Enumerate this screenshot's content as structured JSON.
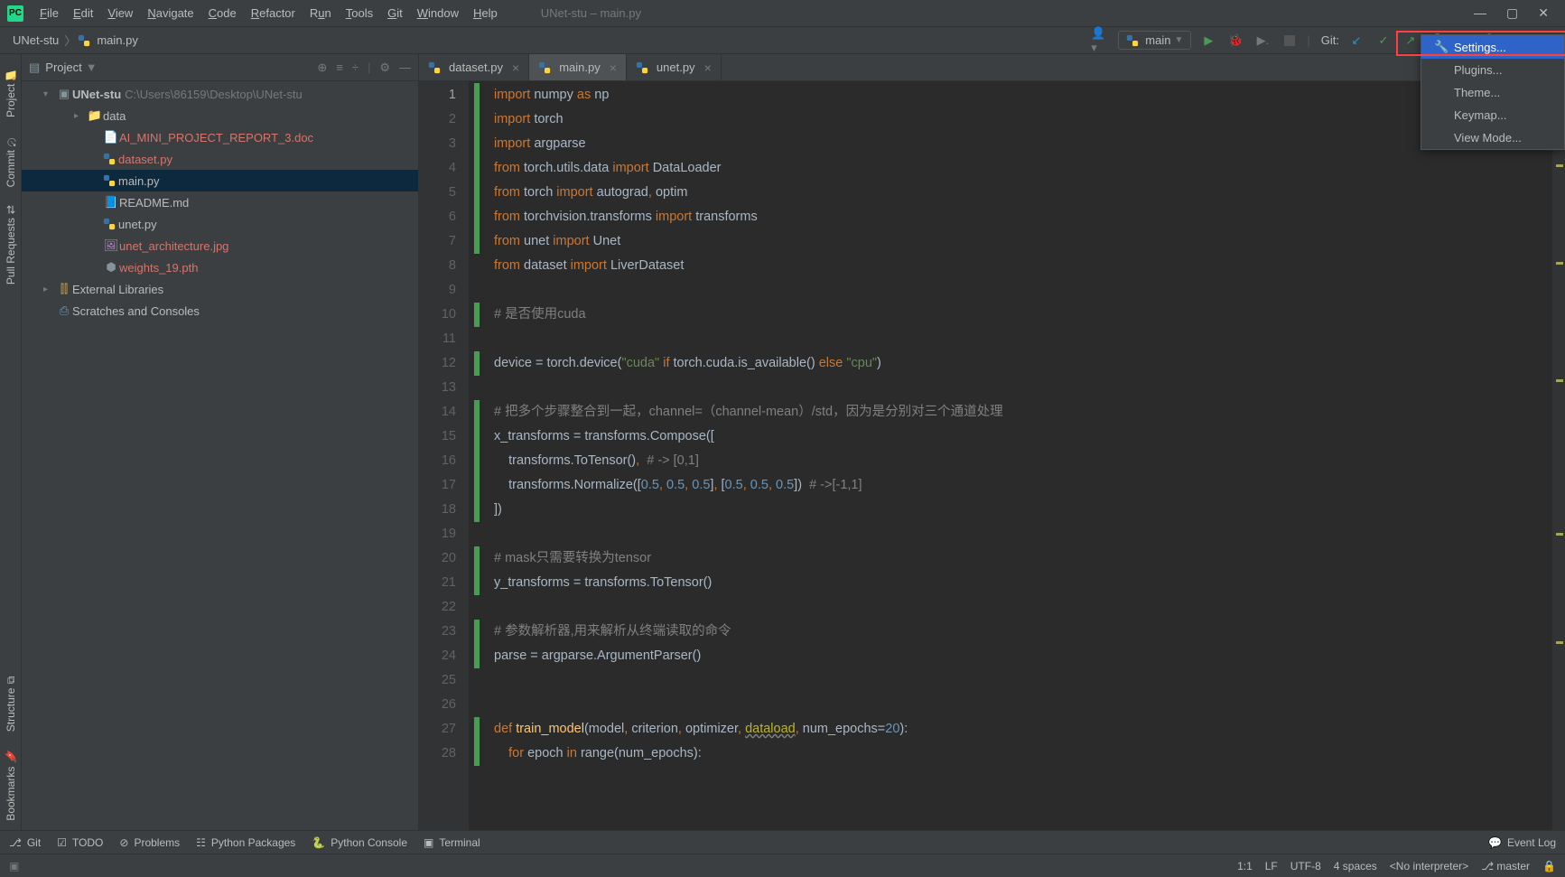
{
  "window": {
    "title": "UNet-stu – main.py"
  },
  "menu": [
    "File",
    "Edit",
    "View",
    "Navigate",
    "Code",
    "Refactor",
    "Run",
    "Tools",
    "Git",
    "Window",
    "Help"
  ],
  "breadcrumb": {
    "project": "UNet-stu",
    "file": "main.py"
  },
  "run_config": {
    "name": "main"
  },
  "git_label": "Git:",
  "project_panel": {
    "title": "Project",
    "root": {
      "name": "UNet-stu",
      "path": "C:\\Users\\86159\\Desktop\\UNet-stu"
    },
    "items": [
      {
        "name": "data",
        "type": "folder"
      },
      {
        "name": "AI_MINI_PROJECT_REPORT_3.doc",
        "type": "doc",
        "vcs": true
      },
      {
        "name": "dataset.py",
        "type": "py",
        "vcs": true
      },
      {
        "name": "main.py",
        "type": "py",
        "vcs": false,
        "selected": true
      },
      {
        "name": "README.md",
        "type": "md",
        "vcs": false
      },
      {
        "name": "unet.py",
        "type": "py",
        "vcs": false
      },
      {
        "name": "unet_architecture.jpg",
        "type": "img",
        "vcs": true
      },
      {
        "name": "weights_19.pth",
        "type": "bin",
        "vcs": true
      }
    ],
    "external": "External Libraries",
    "scratches": "Scratches and Consoles"
  },
  "tabs": [
    {
      "name": "dataset.py",
      "active": false
    },
    {
      "name": "main.py",
      "active": true
    },
    {
      "name": "unet.py",
      "active": false
    }
  ],
  "code_lines": [
    {
      "n": 1,
      "m": "green",
      "html": "<span class='tk-kw'>import</span> <span class='tk-default'>numpy </span><span class='tk-kw'>as</span> <span class='tk-default'>np</span>"
    },
    {
      "n": 2,
      "m": "green",
      "html": "<span class='tk-kw'>import</span> <span class='tk-default'>torch</span>"
    },
    {
      "n": 3,
      "m": "green",
      "html": "<span class='tk-kw'>import</span> <span class='tk-default'>argparse</span>"
    },
    {
      "n": 4,
      "m": "green",
      "html": "<span class='tk-kw'>from</span> <span class='tk-default'>torch.utils.data </span><span class='tk-kw'>import</span> <span class='tk-default'>DataLoader</span>"
    },
    {
      "n": 5,
      "m": "green",
      "html": "<span class='tk-kw'>from</span> <span class='tk-default'>torch </span><span class='tk-kw'>import</span> <span class='tk-default'>autograd</span><span class='tk-kw'>,</span> <span class='tk-default'>optim</span>"
    },
    {
      "n": 6,
      "m": "green",
      "html": "<span class='tk-kw'>from</span> <span class='tk-default'>torchvision.transforms </span><span class='tk-kw'>import</span> <span class='tk-default'>transforms</span>"
    },
    {
      "n": 7,
      "m": "green",
      "html": "<span class='tk-kw'>from</span> <span class='tk-default'>unet </span><span class='tk-kw'>import</span> <span class='tk-default'>Unet</span>"
    },
    {
      "n": 8,
      "m": "",
      "html": "<span class='tk-kw'>from</span> <span class='tk-default'>dataset </span><span class='tk-kw'>import</span> <span class='tk-default'>LiverDataset</span>"
    },
    {
      "n": 9,
      "m": "",
      "html": ""
    },
    {
      "n": 10,
      "m": "green",
      "html": "<span class='tk-cmt'># 是否使用cuda</span>"
    },
    {
      "n": 11,
      "m": "",
      "html": ""
    },
    {
      "n": 12,
      "m": "green",
      "html": "<span class='tk-default'>device = torch.device(</span><span class='tk-str'>\"cuda\"</span> <span class='tk-kw'>if</span> <span class='tk-default'>torch.cuda.is_available() </span><span class='tk-kw'>else</span> <span class='tk-str'>\"cpu\"</span><span class='tk-default'>)</span>"
    },
    {
      "n": 13,
      "m": "",
      "html": ""
    },
    {
      "n": 14,
      "m": "green",
      "html": "<span class='tk-cmt'># 把多个步骤整合到一起，channel=（channel-mean）/std，因为是分别对三个通道处理</span>"
    },
    {
      "n": 15,
      "m": "green",
      "html": "<span class='tk-default'>x_transforms = transforms.Compose([</span>"
    },
    {
      "n": 16,
      "m": "green",
      "html": "    <span class='tk-default'>transforms.ToTensor()</span><span class='tk-kw'>,</span>  <span class='tk-cmt'># -> [0,1]</span>"
    },
    {
      "n": 17,
      "m": "green",
      "html": "    <span class='tk-default'>transforms.Normalize([</span><span class='tk-num'>0.5</span><span class='tk-kw'>,</span> <span class='tk-num'>0.5</span><span class='tk-kw'>,</span> <span class='tk-num'>0.5</span><span class='tk-default'>]</span><span class='tk-kw'>,</span> <span class='tk-default'>[</span><span class='tk-num'>0.5</span><span class='tk-kw'>,</span> <span class='tk-num'>0.5</span><span class='tk-kw'>,</span> <span class='tk-num'>0.5</span><span class='tk-default'>])</span>  <span class='tk-cmt'># ->[-1,1]</span>"
    },
    {
      "n": 18,
      "m": "green",
      "html": "<span class='tk-default'>])</span>"
    },
    {
      "n": 19,
      "m": "",
      "html": ""
    },
    {
      "n": 20,
      "m": "green",
      "html": "<span class='tk-cmt'># mask只需要转换为tensor</span>"
    },
    {
      "n": 21,
      "m": "green",
      "html": "<span class='tk-default'>y_transforms = transforms.ToTensor()</span>"
    },
    {
      "n": 22,
      "m": "",
      "html": ""
    },
    {
      "n": 23,
      "m": "green",
      "html": "<span class='tk-cmt'># 参数解析器,用来解析从终端读取的命令</span>"
    },
    {
      "n": 24,
      "m": "green",
      "html": "<span class='tk-default'>parse = argparse.ArgumentParser()</span>"
    },
    {
      "n": 25,
      "m": "",
      "html": ""
    },
    {
      "n": 26,
      "m": "",
      "html": ""
    },
    {
      "n": 27,
      "m": "green",
      "html": "<span class='tk-kw'>def </span><span class='tk-fn'>train_model</span><span class='tk-default'>(model</span><span class='tk-kw'>,</span> <span class='tk-default'>criterion</span><span class='tk-kw'>,</span> <span class='tk-default'>optimizer</span><span class='tk-kw'>,</span> <span class='tk-warn'>dataload</span><span class='tk-kw'>,</span> <span class='tk-default'>num_epochs=</span><span class='tk-num'>20</span><span class='tk-default'>):</span>"
    },
    {
      "n": 28,
      "m": "green",
      "html": "    <span class='tk-kw'>for</span> <span class='tk-default'>epoch </span><span class='tk-kw'>in</span> <span class='tk-default'>range(num_epochs):</span>"
    }
  ],
  "context_menu": [
    {
      "label": "Settings...",
      "icon": "wrench",
      "selected": true
    },
    {
      "label": "Plugins...",
      "icon": ""
    },
    {
      "label": "Theme...",
      "icon": ""
    },
    {
      "label": "Keymap...",
      "icon": ""
    },
    {
      "label": "View Mode...",
      "icon": ""
    }
  ],
  "bottom_tools": {
    "git": "Git",
    "todo": "TODO",
    "problems": "Problems",
    "packages": "Python Packages",
    "console": "Python Console",
    "terminal": "Terminal",
    "event_log": "Event Log"
  },
  "status": {
    "pos": "1:1",
    "line_sep": "LF",
    "encoding": "UTF-8",
    "indent": "4 spaces",
    "interpreter": "<No interpreter>",
    "branch": "master"
  },
  "gutter_tabs": {
    "project": "Project",
    "commit": "Commit",
    "pull_requests": "Pull Requests",
    "structure": "Structure",
    "bookmarks": "Bookmarks"
  }
}
